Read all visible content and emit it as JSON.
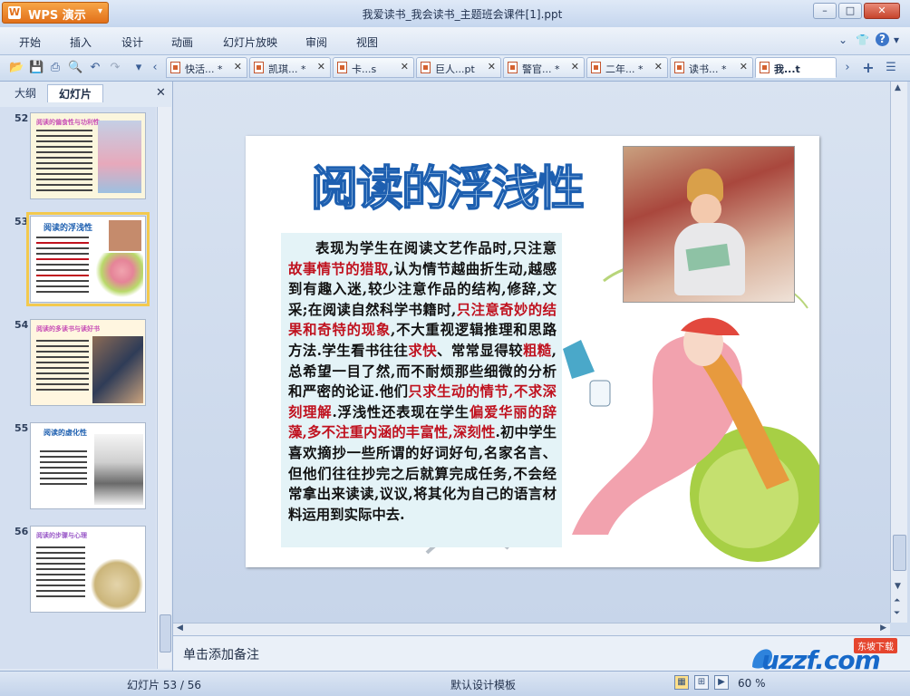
{
  "titlebar": {
    "app_name": "WPS 演示",
    "doc_title": "我爱读书_我会读书_主题班会课件[1].ppt"
  },
  "menu": [
    "开始",
    "插入",
    "设计",
    "动画",
    "幻灯片放映",
    "审阅",
    "视图"
  ],
  "tabs": [
    {
      "label": "快活... *"
    },
    {
      "label": "凯琪... *"
    },
    {
      "label": "卡...s"
    },
    {
      "label": "巨人...pt"
    },
    {
      "label": "警官... *"
    },
    {
      "label": "二年... *"
    },
    {
      "label": "读书... *"
    },
    {
      "label": "我...t"
    }
  ],
  "left_pane": {
    "tab_outline": "大纲",
    "tab_slides": "幻灯片",
    "thumbs": [
      {
        "number": "52",
        "title": "阅读的偏食性与功利性"
      },
      {
        "number": "53",
        "title": "阅读的浮浅性"
      },
      {
        "number": "54",
        "title": "阅读的多读书与读好书"
      },
      {
        "number": "55",
        "title": "阅读的虚化性"
      },
      {
        "number": "56",
        "title": "阅读的步骤与心理"
      }
    ]
  },
  "slide": {
    "title": "阅读的浮浅性",
    "body_segments": [
      {
        "text": "表现为学生在阅读文艺作品时,只注意",
        "hl": false
      },
      {
        "text": "故事情节的猎取",
        "hl": true
      },
      {
        "text": ",认为情节越曲折生动,越感到有趣入迷,较少注意作品的结构,修辞,文采;在阅读自然科学书籍时,",
        "hl": false
      },
      {
        "text": "只注意奇妙的结果和奇特的现象",
        "hl": true
      },
      {
        "text": ",不大重视逻辑推理和思路方法.学生看书往往",
        "hl": false
      },
      {
        "text": "求快",
        "hl": true
      },
      {
        "text": "、常常显得较",
        "hl": false
      },
      {
        "text": "粗糙",
        "hl": true
      },
      {
        "text": ",总希望一目了然,而不耐烦那些细微的分析和严密的论证.他们",
        "hl": false
      },
      {
        "text": "只求生动的情节,不求深刻理解",
        "hl": true
      },
      {
        "text": ".浮浅性还表现在学生",
        "hl": false
      },
      {
        "text": "偏爱华丽的辞藻,多不注重内涵的丰富性,深刻性",
        "hl": true
      },
      {
        "text": ".初中学生喜欢摘抄一些所谓的好词好句,名家名言、但他们往往抄完之后就算完成任务,不会经常拿出来读读,议议,将其化为自己的语言材料运用到实际中去.",
        "hl": false
      }
    ]
  },
  "notes": {
    "placeholder": "单击添加备注"
  },
  "status": {
    "slide_info": "幻灯片 53 / 56",
    "template": "默认设计模板",
    "zoom": "60 %"
  },
  "watermark": {
    "brand": "uzzf.com",
    "tag": "东坡下载"
  },
  "colors": {
    "accent": "#1d5fb0",
    "highlight": "#c0121f",
    "wps_orange": "#e2701a"
  }
}
